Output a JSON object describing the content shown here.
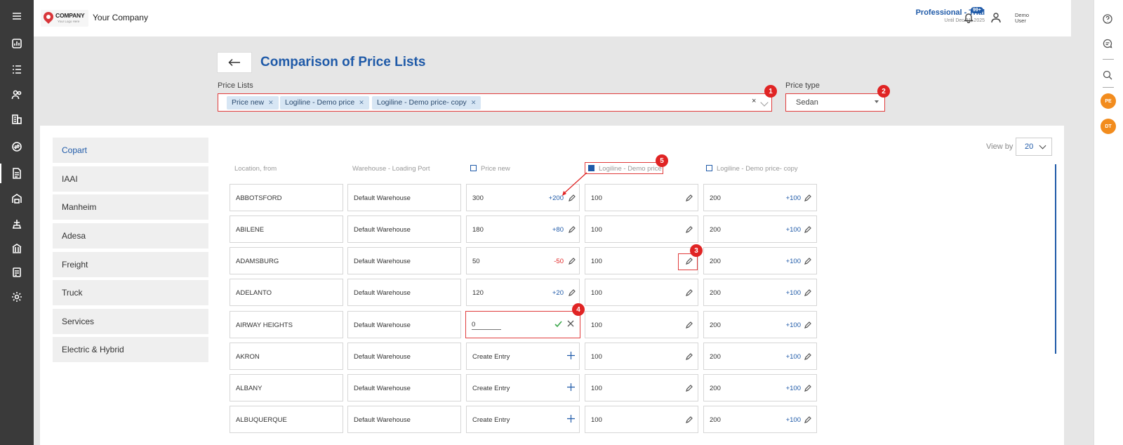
{
  "sidebar": {
    "items": [
      {
        "name": "menu-icon"
      },
      {
        "name": "dashboard-icon"
      },
      {
        "name": "list-icon"
      },
      {
        "name": "users-icon"
      },
      {
        "name": "building-icon"
      },
      {
        "name": "exchange-icon"
      },
      {
        "name": "price-list-icon",
        "active": true
      },
      {
        "name": "warehouse-icon"
      },
      {
        "name": "port-icon"
      },
      {
        "name": "bank-icon"
      },
      {
        "name": "invoice-icon"
      },
      {
        "name": "settings-icon"
      }
    ]
  },
  "header": {
    "logo_name": "COMPANY",
    "logo_sub": "Your Logo Here",
    "company_name": "Your Company",
    "plan_title": "Professional - Trial",
    "plan_until": "Until Dec 31, 2025",
    "notifications_badge": "99+",
    "user_name": "Demo User"
  },
  "right_rail": {
    "avatars": [
      "PE",
      "DT"
    ]
  },
  "page": {
    "title": "Comparison of Price Lists",
    "price_lists_label": "Price Lists",
    "price_lists_selected": [
      "Price new",
      "Logiline - Demo price",
      "Logiline - Demo price- copy"
    ],
    "price_type_label": "Price type",
    "price_type_value": "Sedan",
    "view_by_label": "View by",
    "view_by_value": "20"
  },
  "annotations": [
    "1",
    "2",
    "3",
    "4",
    "5"
  ],
  "categories": [
    {
      "label": "Copart",
      "active": true
    },
    {
      "label": "IAAI"
    },
    {
      "label": "Manheim"
    },
    {
      "label": "Adesa"
    },
    {
      "label": "Freight"
    },
    {
      "label": "Truck"
    },
    {
      "label": "Services"
    },
    {
      "label": "Electric & Hybrid"
    }
  ],
  "table": {
    "columns": [
      "Location, from",
      "Warehouse - Loading Port",
      "Price new",
      "Logiline - Demo price",
      "Logiline - Demo price- copy"
    ],
    "rows": [
      {
        "location": "ABBOTSFORD",
        "warehouse": "Default Warehouse",
        "p1": "300",
        "p1_delta": "+200",
        "p2": "100",
        "p3": "200",
        "p3_delta": "+100"
      },
      {
        "location": "ABILENE",
        "warehouse": "Default Warehouse",
        "p1": "180",
        "p1_delta": "+80",
        "p2": "100",
        "p3": "200",
        "p3_delta": "+100"
      },
      {
        "location": "ADAMSBURG",
        "warehouse": "Default Warehouse",
        "p1": "50",
        "p1_delta": "-50",
        "p2": "100",
        "p3": "200",
        "p3_delta": "+100"
      },
      {
        "location": "ADELANTO",
        "warehouse": "Default Warehouse",
        "p1": "120",
        "p1_delta": "+20",
        "p2": "100",
        "p3": "200",
        "p3_delta": "+100"
      },
      {
        "location": "AIRWAY HEIGHTS",
        "warehouse": "Default Warehouse",
        "p1_edit_value": "0",
        "p2": "100",
        "p3": "200",
        "p3_delta": "+100"
      },
      {
        "location": "AKRON",
        "warehouse": "Default Warehouse",
        "p1": "Create Entry",
        "p2": "100",
        "p3": "200",
        "p3_delta": "+100"
      },
      {
        "location": "ALBANY",
        "warehouse": "Default Warehouse",
        "p1": "Create Entry",
        "p2": "100",
        "p3": "200",
        "p3_delta": "+100"
      },
      {
        "location": "ALBUQUERQUE",
        "warehouse": "Default Warehouse",
        "p1": "Create Entry",
        "p2": "100",
        "p3": "200",
        "p3_delta": "+100"
      }
    ]
  }
}
